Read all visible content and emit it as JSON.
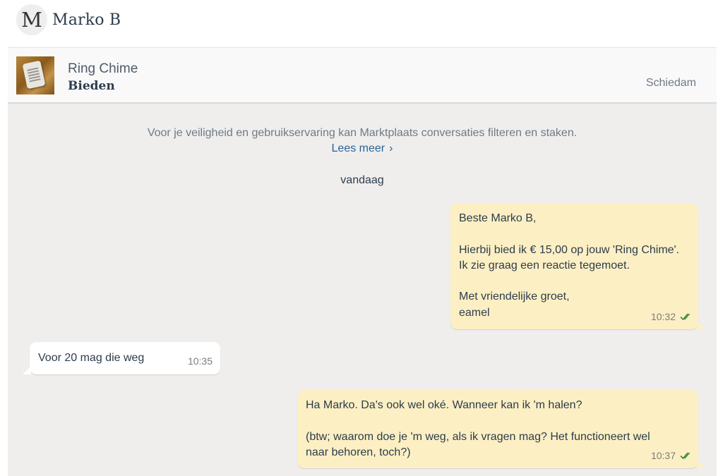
{
  "header": {
    "avatar_letter": "M",
    "contact_name": "Marko B"
  },
  "listing": {
    "title": "Ring Chime",
    "subtitle": "Bieden",
    "location": "Schiedam"
  },
  "notice": {
    "text": "Voor je veiligheid en gebruikservaring kan Marktplaats conversaties filteren en staken.",
    "link_label": "Lees meer",
    "link_chevron": "›"
  },
  "date_separator": "vandaag",
  "messages": [
    {
      "direction": "outgoing",
      "text": "Beste Marko B,\n\nHierbij bied ik € 15,00 op jouw 'Ring Chime'.\nIk zie graag een reactie tegemoet.\n\nMet vriendelijke groet,\neamel",
      "time": "10:32",
      "status_icon": "double-check-icon"
    },
    {
      "direction": "incoming",
      "text": "Voor 20 mag die weg",
      "time": "10:35"
    },
    {
      "direction": "outgoing",
      "text": "Ha Marko. Da's ook wel oké. Wanneer kan ik 'm halen?\n\n(btw; waarom doe je 'm weg, als ik vragen mag? Het functioneert wel\nnaar behoren, toch?)",
      "time": "10:37",
      "status_icon": "double-check-icon"
    }
  ],
  "colors": {
    "outgoing_bubble": "#fcefc3",
    "incoming_bubble": "#ffffff",
    "chat_background": "#efeeed",
    "link": "#2a6496",
    "read_tick": "#3a8a3a"
  }
}
